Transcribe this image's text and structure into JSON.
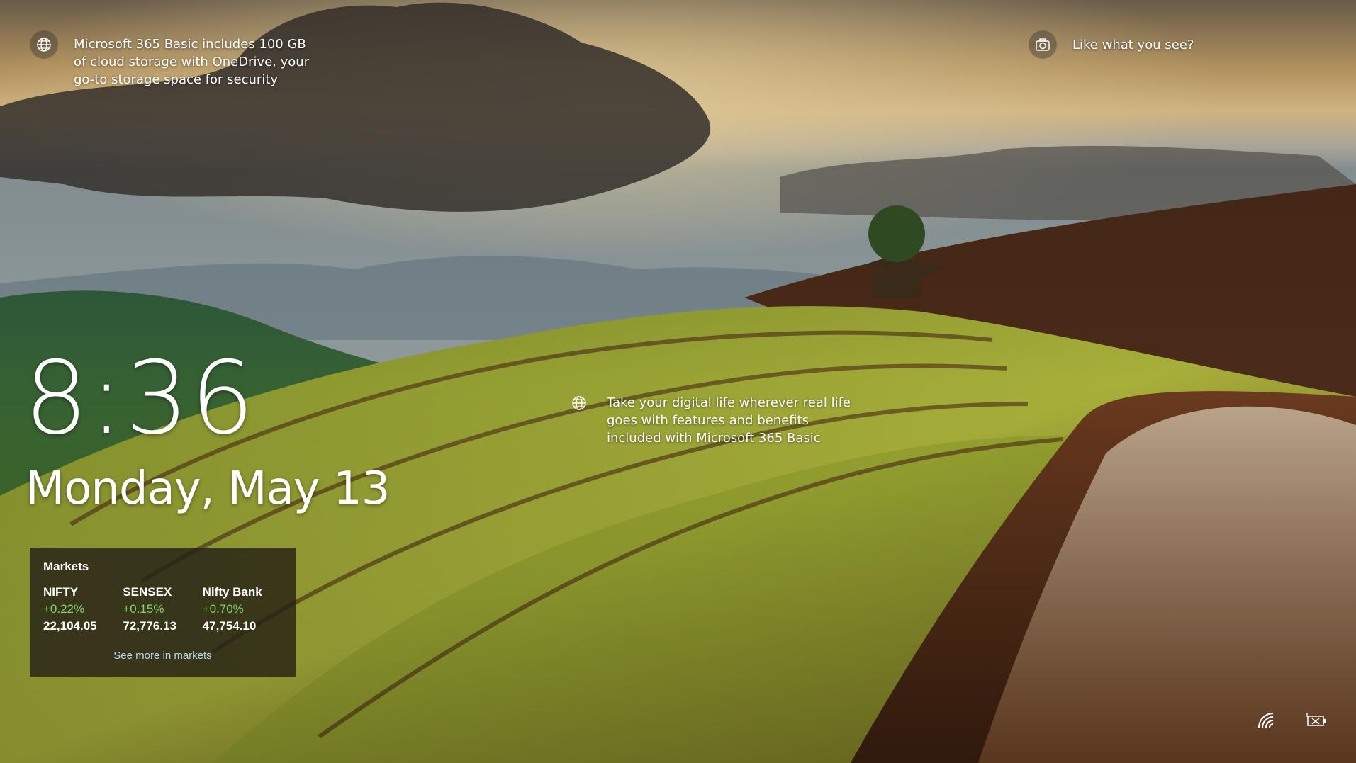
{
  "spotlight": {
    "top_left": "Microsoft 365 Basic includes 100 GB of cloud storage with OneDrive, your go-to storage space for security",
    "top_right": "Like what you see?",
    "middle": "Take your digital life wherever real life goes with features and benefits included with Microsoft 365 Basic"
  },
  "clock": {
    "time": "8:36",
    "date": "Monday, May 13"
  },
  "markets": {
    "title": "Markets",
    "tickers": [
      {
        "name": "NIFTY",
        "change": "+0.22%",
        "price": "22,104.05"
      },
      {
        "name": "SENSEX",
        "change": "+0.15%",
        "price": "72,776.13"
      },
      {
        "name": "Nifty Bank",
        "change": "+0.70%",
        "price": "47,754.10"
      }
    ],
    "link_label": "See more in markets",
    "positive_color": "#7fd46b"
  },
  "icons": {
    "spotlight_globe": "globe-icon",
    "spotlight_camera": "camera-icon",
    "network": "wifi-icon",
    "battery": "battery-icon"
  }
}
